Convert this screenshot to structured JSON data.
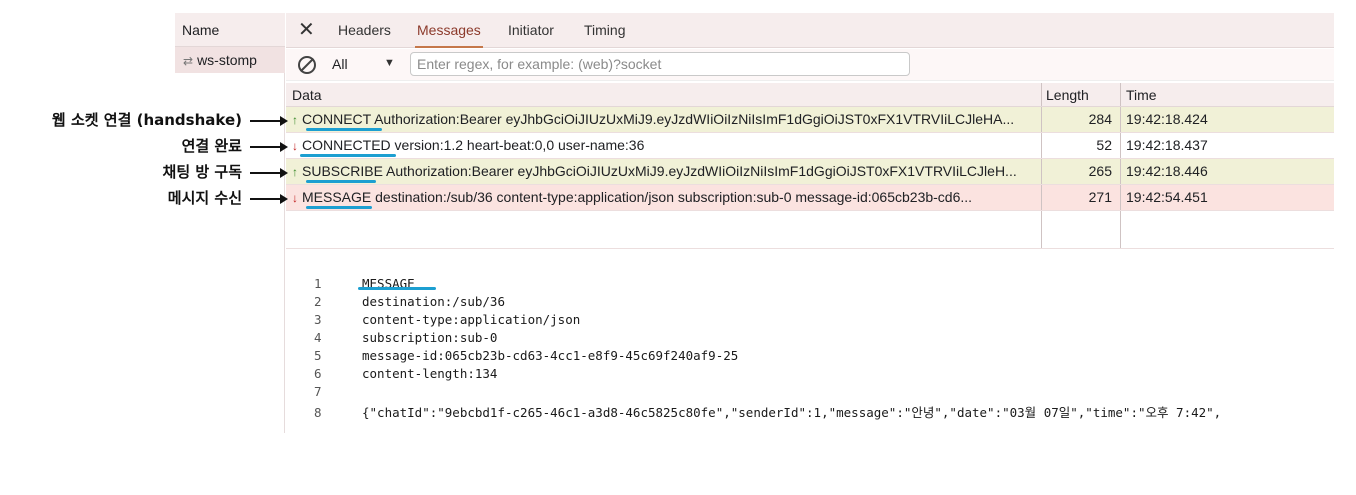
{
  "name_column": {
    "header": "Name",
    "item": "ws-stomp"
  },
  "tabs": {
    "close_icon": "close-icon",
    "items": [
      "Headers",
      "Messages",
      "Initiator",
      "Timing"
    ],
    "active": "Messages"
  },
  "filter": {
    "selected": "All",
    "placeholder": "Enter regex, for example: (web)?socket"
  },
  "grid": {
    "columns": [
      "Data",
      "Length",
      "Time"
    ],
    "rows": [
      {
        "direction": "sent",
        "data": "CONNECT Authorization:Bearer eyJhbGciOiJIUzUxMiJ9.eyJzdWIiOiIzNiIsImF1dGgiOiJST0xFX1VTRVIiLCJleHA...",
        "length": "284",
        "time": "19:42:18.424"
      },
      {
        "direction": "received",
        "data": "CONNECTED version:1.2 heart-beat:0,0 user-name:36",
        "length": "52",
        "time": "19:42:18.437"
      },
      {
        "direction": "sent",
        "data": "SUBSCRIBE Authorization:Bearer eyJhbGciOiJIUzUxMiJ9.eyJzdWIiOiIzNiIsImF1dGgiOiJST0xFX1VTRVIiLCJleH...",
        "length": "265",
        "time": "19:42:18.446"
      },
      {
        "direction": "received",
        "data": "MESSAGE destination:/sub/36 content-type:application/json subscription:sub-0 message-id:065cb23b-cd6...",
        "length": "271",
        "time": "19:42:54.451"
      }
    ]
  },
  "detail": {
    "lines": [
      {
        "n": "1",
        "text": "MESSAGE"
      },
      {
        "n": "2",
        "text": "destination:/sub/36"
      },
      {
        "n": "3",
        "text": "content-type:application/json"
      },
      {
        "n": "4",
        "text": "subscription:sub-0"
      },
      {
        "n": "5",
        "text": "message-id:065cb23b-cd63-4cc1-e8f9-45c69f240af9-25"
      },
      {
        "n": "6",
        "text": "content-length:134"
      },
      {
        "n": "7",
        "text": ""
      },
      {
        "n": "8",
        "text": "{\"chatId\":\"9ebcbd1f-c265-46c1-a3d8-46c5825c80fe\",\"senderId\":1,\"message\":\"안녕\",\"date\":\"03월 07일\",\"time\":\"오후 7:42\","
      }
    ]
  },
  "annotations": [
    "웹 소켓 연결 (handshake)",
    "연결 완료",
    "채팅 방 구독",
    "메시지 수신"
  ],
  "colors": {
    "sent_row": "#f1f1d7",
    "highlight_row": "#fbe3e0",
    "underline": "#1c9fd1",
    "active_tab": "#8c3a2b"
  }
}
